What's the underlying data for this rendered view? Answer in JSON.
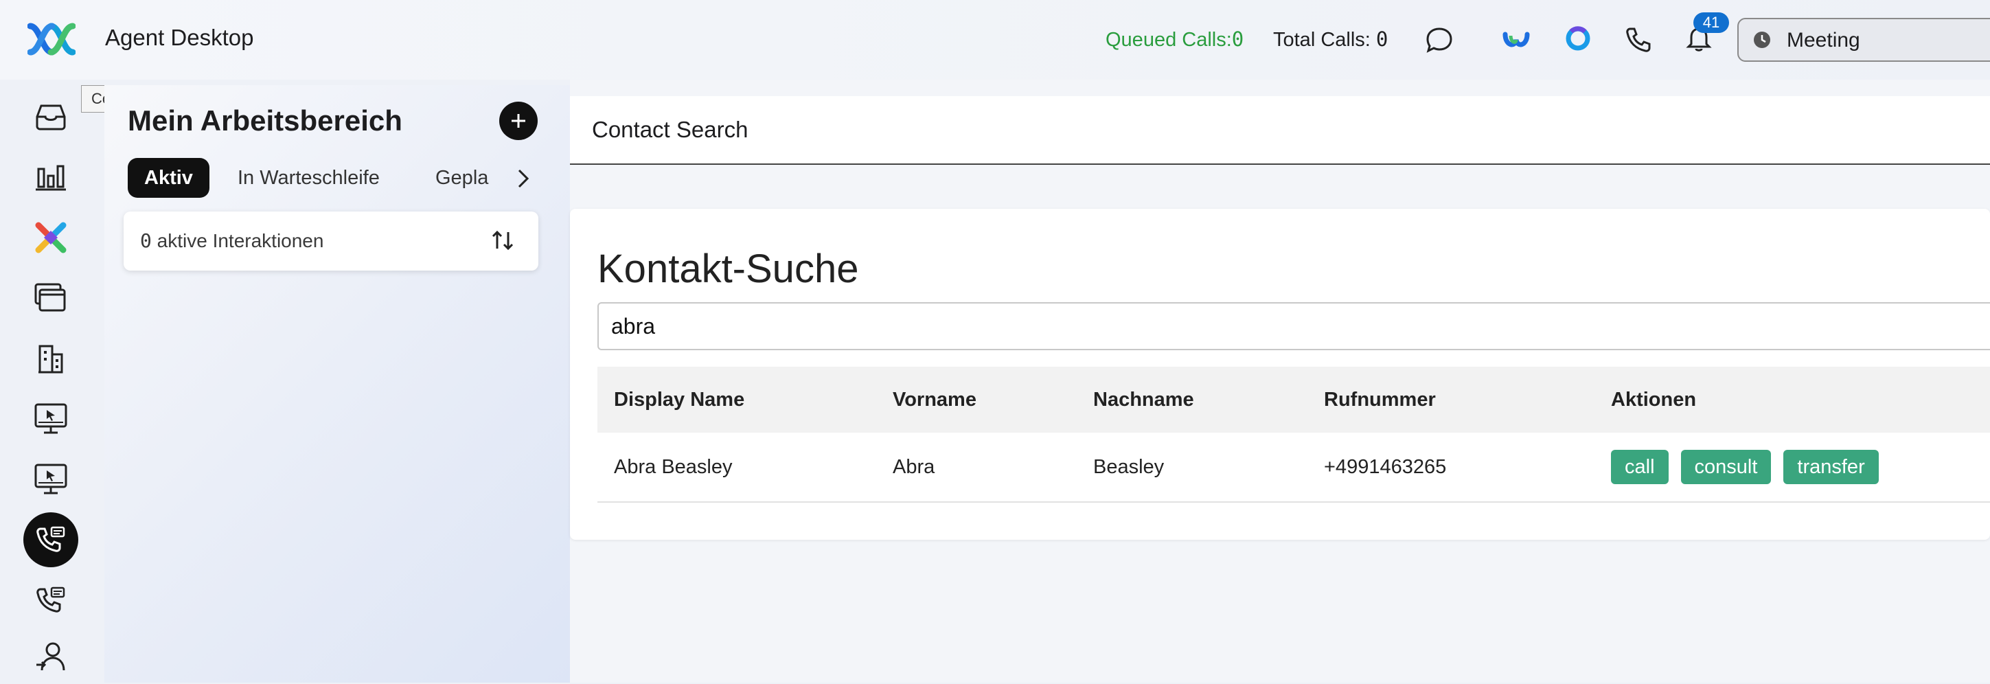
{
  "app": {
    "title": "Agent Desktop"
  },
  "topbar": {
    "queued_label": "Queued Calls:",
    "queued_value": "0",
    "total_label": "Total Calls: ",
    "total_value": "0",
    "notifications_count": "41",
    "status": "Meeting",
    "icons": [
      "chat-icon",
      "webex-icon",
      "cisco-ai-icon",
      "phone-icon",
      "bell-icon",
      "clock-icon"
    ]
  },
  "nav": {
    "tooltip": "Contact Search",
    "items": [
      "inbox-icon",
      "bar-chart-icon",
      "webex-app-icon",
      "windows-icon",
      "buildings-icon",
      "monitor-cursor-icon",
      "monitor-cursor-icon",
      "contact-search-phone-icon",
      "phone-contacts-icon",
      "user-login-icon"
    ]
  },
  "workspace": {
    "title": "Mein Arbeitsbereich",
    "tabs": [
      "Aktiv",
      "In Warteschleife",
      "Gepla"
    ],
    "interactions_count": "0",
    "interactions_label": " aktive Interaktionen"
  },
  "main": {
    "header_title": "Contact Search",
    "heading": "Kontakt-Suche",
    "search_value": "abra",
    "columns": [
      "Display Name",
      "Vorname",
      "Nachname",
      "Rufnummer",
      "Aktionen"
    ],
    "rows": [
      {
        "display_name": "Abra Beasley",
        "first_name": "Abra",
        "last_name": "Beasley",
        "phone": "+4991463265",
        "actions": [
          "call",
          "consult",
          "transfer"
        ]
      }
    ]
  },
  "colors": {
    "queued_green": "#2a9d3e",
    "action_button": "#3aa57e",
    "badge_blue": "#1170cf",
    "active_dark": "#111111"
  }
}
